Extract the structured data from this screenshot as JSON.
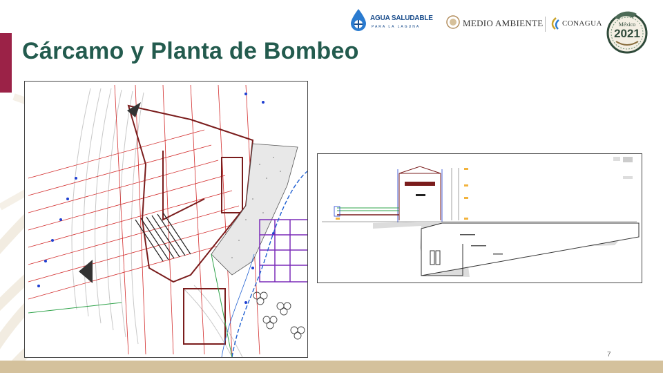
{
  "slide": {
    "title": "Cárcamo y Planta de Bombeo",
    "page_number": "7"
  },
  "logos": {
    "agua_saludable": {
      "title": "AGUA SALUDABLE",
      "subtitle": "PARA LA LAGUNA"
    },
    "medio_ambiente": {
      "title": "MEDIO AMBIENTE"
    },
    "conagua": {
      "title": "CONAGUA"
    },
    "mexico_2021": {
      "year": "2021",
      "country": "México"
    }
  },
  "images": {
    "plan_view": {
      "icon": "engineering-plan-drawing"
    },
    "section_view": {
      "icon": "engineering-section-drawing"
    }
  },
  "colors": {
    "title": "#235b4e",
    "accent_bar": "#9b2247",
    "footer_band": "#d4c19c"
  }
}
